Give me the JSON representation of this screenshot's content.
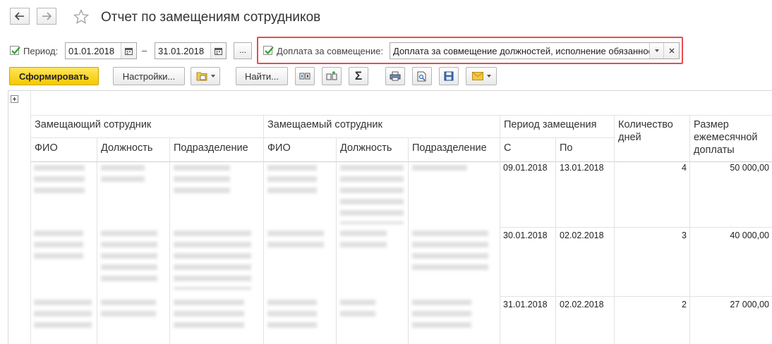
{
  "window": {
    "title": "Отчет по замещениям сотрудников",
    "icons": {
      "back": "arrow-left-icon",
      "forward": "arrow-right-icon",
      "favorite": "star-icon"
    }
  },
  "filters": {
    "period_label": "Период:",
    "period_checked": true,
    "date_from": "01.01.2018",
    "date_separator": "–",
    "date_to": "31.01.2018",
    "dots_label": "...",
    "doplata_label": "Доплата за совмещение:",
    "doplata_checked": true,
    "doplata_value": "Доплата за совмещение должностей, исполнение обязанностей"
  },
  "toolbar": {
    "generate_label": "Сформировать",
    "settings_label": "Настройки...",
    "find_label": "Найти...",
    "sum_symbol": "Σ"
  },
  "report": {
    "group_headers": {
      "replacing": "Замещающий сотрудник",
      "replaced": "Замещаемый сотрудник",
      "period": "Период замещения",
      "days": "Количество дней",
      "amount": "Размер ежемесячной доплаты"
    },
    "sub_headers": {
      "fio1": "ФИО",
      "position1": "Должность",
      "department1": "Подразделение",
      "fio2": "ФИО",
      "position2": "Должность",
      "department2": "Подразделение",
      "from": "С",
      "to": "По"
    },
    "rows": [
      {
        "from": "09.01.2018",
        "to": "13.01.2018",
        "days": "4",
        "amount": "50 000,00"
      },
      {
        "from": "30.01.2018",
        "to": "02.02.2018",
        "days": "3",
        "amount": "40 000,00"
      },
      {
        "from": "31.01.2018",
        "to": "02.02.2018",
        "days": "2",
        "amount": "27 000,00"
      }
    ]
  }
}
